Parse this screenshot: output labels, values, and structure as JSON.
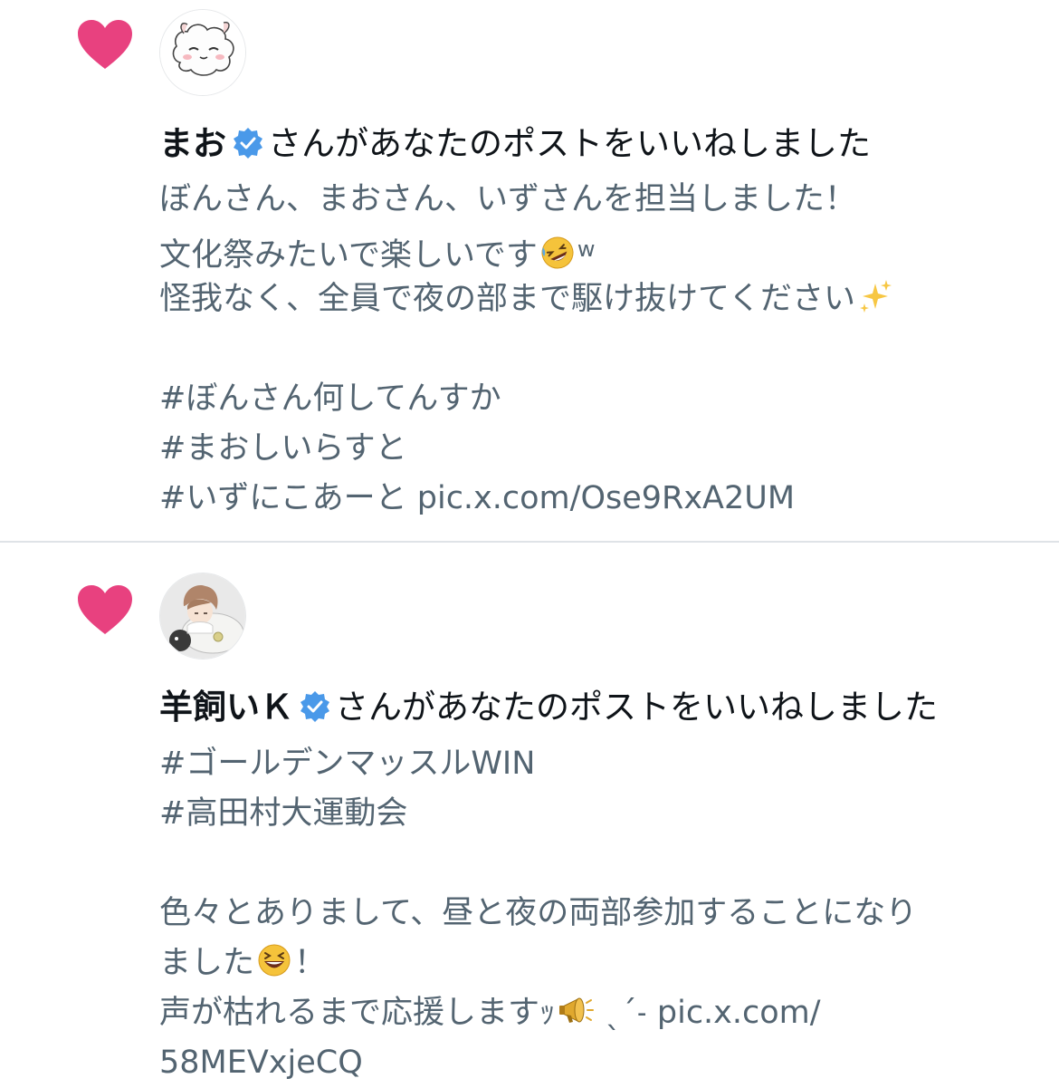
{
  "notifications": [
    {
      "user": "まお",
      "action": "さんがあなたのポストをいいねしました",
      "lines": [
        "ぼんさん、まおさん、いずさんを担当しました！",
        "文化祭みたいで楽しいです",
        "怪我なく、全員で夜の部まで駆け抜けてください",
        "",
        "#ぼんさん何してんすか",
        "#まおしいらすと",
        "#いずにこあーと pic.x.com/Ose9RxA2UM"
      ],
      "laugh_suffix": "w",
      "emojis": [
        "rofl-emoji",
        "sparkles-emoji"
      ]
    },
    {
      "user": "羊飼いＫ",
      "action": "さんがあなたのポストをいいねしました",
      "lines": [
        "#ゴールデンマッスルWIN",
        "#高田村大運動会",
        "",
        "色々とありまして、昼と夜の両部参加することになり",
        "ました",
        "声が枯れるまで応援しますｯ",
        "58MEVxjeCQ"
      ],
      "exclaim": "！",
      "line6_tail": " ˎˊ˗ pic.x.com/",
      "emojis": [
        "grinning-squinting-emoji",
        "megaphone-emoji"
      ]
    }
  ],
  "colors": {
    "heart": "#e8417f",
    "verified": "#4a99e9",
    "body_text": "#536471",
    "divider": "#dfe3e7"
  },
  "icons": [
    "heart-icon",
    "verified-badge-icon",
    "avatar-sheep-cartoon",
    "avatar-boy-with-sheep"
  ]
}
